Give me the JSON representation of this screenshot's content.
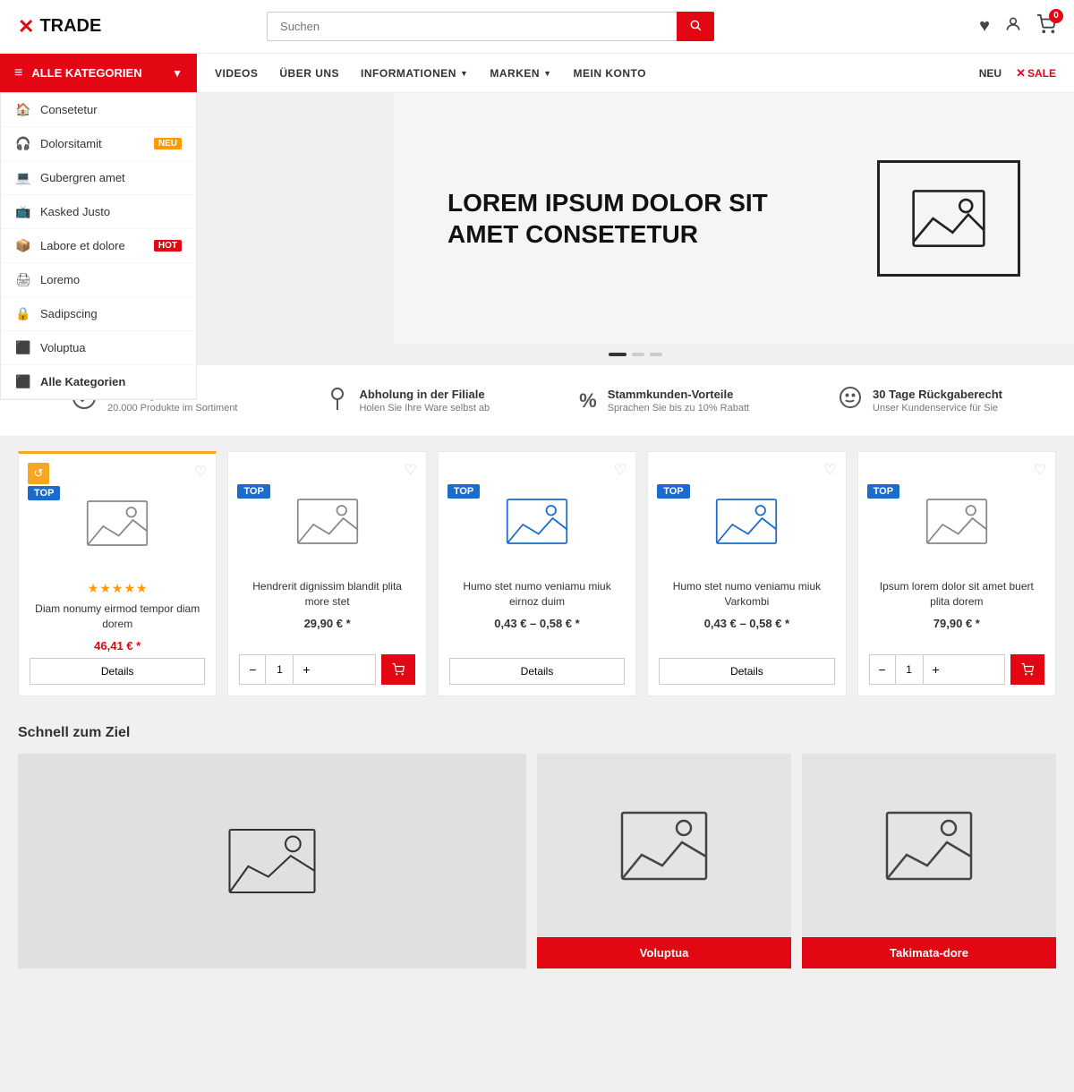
{
  "header": {
    "logo_text": "TRADE",
    "search_placeholder": "Suchen",
    "cart_count": "0"
  },
  "nav": {
    "all_categories": "ALLE KATEGORIEN",
    "links": [
      {
        "label": "VIDEOS"
      },
      {
        "label": "ÜBER UNS"
      },
      {
        "label": "INFORMATIONEN",
        "has_dropdown": true
      },
      {
        "label": "MARKEN",
        "has_dropdown": true
      },
      {
        "label": "MEIN KONTO"
      }
    ],
    "neu_label": "NEU",
    "sale_label": "SALE"
  },
  "sidebar": {
    "items": [
      {
        "label": "Consetetur",
        "icon": "🏠"
      },
      {
        "label": "Dolorsitamit",
        "icon": "🎧",
        "badge": "NEU"
      },
      {
        "label": "Gubergren amet",
        "icon": "💻"
      },
      {
        "label": "Kasked Justo",
        "icon": "📺"
      },
      {
        "label": "Labore et dolore",
        "icon": "📦",
        "badge": "HOT"
      },
      {
        "label": "Loremo",
        "icon": "🖨"
      },
      {
        "label": "Sadipscing",
        "icon": "🔒"
      },
      {
        "label": "Voluptua",
        "icon": "⬛"
      },
      {
        "label": "Alle Kategorien",
        "icon": "⬛",
        "bold": true
      }
    ]
  },
  "hero": {
    "title": "LOREM IPSUM DOLOR SIT AMET CONSETETUR"
  },
  "features": [
    {
      "icon": "✓",
      "title": "Vielfältigkeit",
      "desc": "20.000 Produkte im Sortiment"
    },
    {
      "icon": "📍",
      "title": "Abholung in der Filiale",
      "desc": "Holen Sie Ihre Ware selbst ab"
    },
    {
      "icon": "%",
      "title": "Stammkunden-Vorteile",
      "desc": "Sprachen Sie bis zu 10% Rabatt"
    },
    {
      "icon": "☺",
      "title": "30 Tage Rückgaberecht",
      "desc": "Unser Kundenservice für Sie"
    }
  ],
  "products": [
    {
      "top_badge": "TOP",
      "has_recycle": true,
      "has_stars": true,
      "name": "Diam nonumy eirmod tempor diam dorem",
      "price": "46,41 € *",
      "price_red": true,
      "action": "details",
      "image_colored": false
    },
    {
      "top_badge": "TOP",
      "has_recycle": false,
      "has_stars": false,
      "name": "Hendrerit dignissim blandit plita more stet",
      "price": "29,90 € *",
      "price_red": false,
      "action": "cart",
      "image_colored": false
    },
    {
      "top_badge": "TOP",
      "has_recycle": false,
      "has_stars": false,
      "name": "Humo stet numo veniamu miuk eirnoz duim",
      "price": "0,43 € – 0,58 € *",
      "price_red": false,
      "action": "details",
      "image_colored": true
    },
    {
      "top_badge": "TOP",
      "has_recycle": false,
      "has_stars": false,
      "name": "Humo stet numo veniamu miuk Varkombi",
      "price": "0,43 € – 0,58 € *",
      "price_red": false,
      "action": "details",
      "image_colored": true
    },
    {
      "top_badge": "TOP",
      "has_recycle": false,
      "has_stars": false,
      "name": "Ipsum lorem dolor sit amet buert plita dorem",
      "price": "79,90 € *",
      "price_red": false,
      "action": "cart",
      "image_colored": false
    }
  ],
  "quick_section": {
    "title": "Schnell zum Ziel",
    "cards": [
      {
        "label": "",
        "large": true
      },
      {
        "label": "Voluptua"
      },
      {
        "label": "Takimata-dore"
      }
    ]
  },
  "labels": {
    "details": "Details",
    "top": "TOP",
    "neu": "NEU",
    "sale": "✕ SALE"
  }
}
